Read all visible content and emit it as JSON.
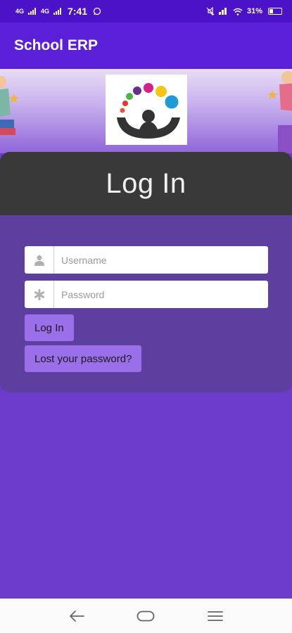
{
  "status_bar": {
    "signal_1": "4G",
    "signal_2": "4G",
    "time": "7:41",
    "battery": "31%"
  },
  "app_bar": {
    "title": "School ERP"
  },
  "login": {
    "heading": "Log In",
    "username_placeholder": "Username",
    "password_placeholder": "Password",
    "login_button": "Log In",
    "lost_password_button": "Lost your password?"
  },
  "colors": {
    "status_bar": "#4b12c8",
    "app_bar": "#5a1fd6",
    "background": "#6b3bcc",
    "card": "#5c3f9f",
    "card_header": "#393939",
    "button": "#9b6fea"
  },
  "icons": {
    "username": "user-icon",
    "password": "asterisk-icon",
    "nav_back": "back-arrow-icon",
    "nav_home": "home-icon",
    "nav_menu": "menu-icon"
  }
}
